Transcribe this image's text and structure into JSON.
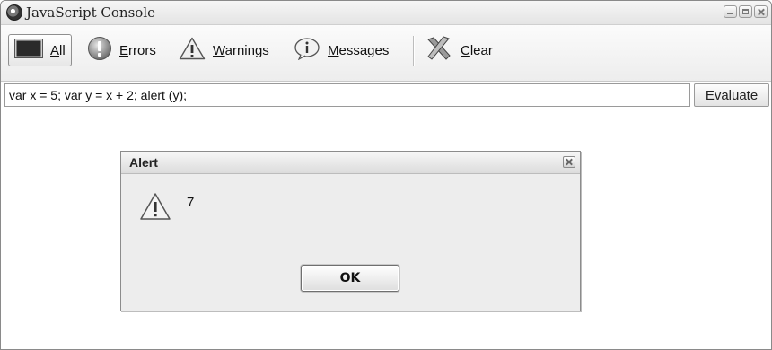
{
  "window": {
    "title": "JavaScript Console"
  },
  "toolbar": {
    "all": {
      "label": "All",
      "underline_char": "A",
      "icon": "console-icon"
    },
    "errors": {
      "label": "Errors",
      "underline_char": "E",
      "icon": "error-icon"
    },
    "warnings": {
      "label": "Warnings",
      "underline_char": "W",
      "icon": "warning-icon"
    },
    "messages": {
      "label": "Messages",
      "underline_char": "M",
      "icon": "info-icon"
    },
    "clear": {
      "label": "Clear",
      "underline_char": "C",
      "icon": "clear-x-icon"
    },
    "active_tab": "All"
  },
  "command": {
    "value": "var x = 5; var y = x + 2; alert (y);",
    "evaluate_label": "Evaluate"
  },
  "alert": {
    "title": "Alert",
    "message": "7",
    "ok_label": "OK",
    "icon": "warning-icon"
  }
}
